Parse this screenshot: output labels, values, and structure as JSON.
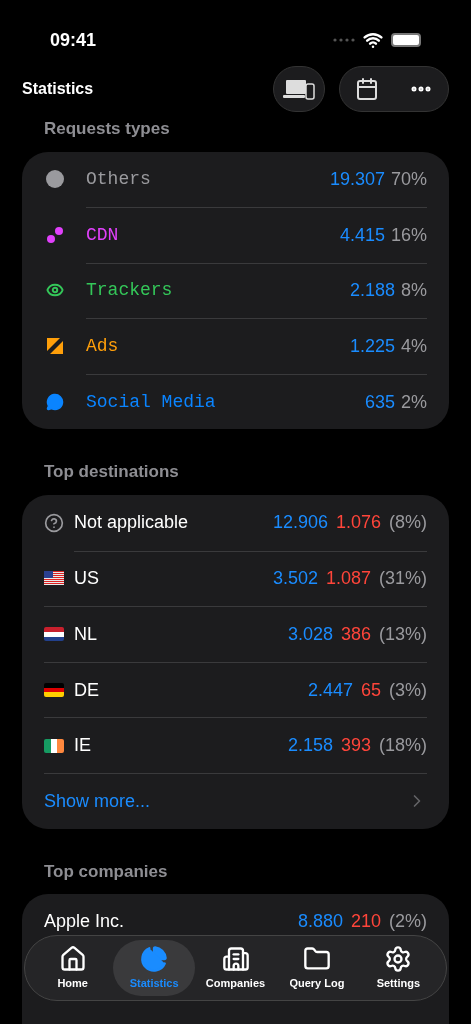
{
  "status_bar": {
    "time": "09:41"
  },
  "header": {
    "title": "Statistics"
  },
  "request_types": {
    "title": "Requests types",
    "items": [
      {
        "label": "Others",
        "count": "19.307",
        "percent": "70%",
        "color": "#9a9a9e"
      },
      {
        "label": "CDN",
        "count": "4.415",
        "percent": "16%",
        "color": "#e040fb"
      },
      {
        "label": "Trackers",
        "count": "2.188",
        "percent": "8%",
        "color": "#34c759"
      },
      {
        "label": "Ads",
        "count": "1.225",
        "percent": "4%",
        "color": "#ff9f0a"
      },
      {
        "label": "Social Media",
        "count": "635",
        "percent": "2%",
        "color": "#0a84ff"
      }
    ]
  },
  "top_destinations": {
    "title": "Top destinations",
    "items": [
      {
        "kind": "unknown",
        "label": "Not applicable",
        "total": "12.906",
        "blocked": "1.076",
        "percent": "(8%)"
      },
      {
        "kind": "us",
        "label": "US",
        "total": "3.502",
        "blocked": "1.087",
        "percent": "(31%)"
      },
      {
        "kind": "nl",
        "label": "NL",
        "total": "3.028",
        "blocked": "386",
        "percent": "(13%)"
      },
      {
        "kind": "de",
        "label": "DE",
        "total": "2.447",
        "blocked": "65",
        "percent": "(3%)"
      },
      {
        "kind": "ie",
        "label": "IE",
        "total": "2.158",
        "blocked": "393",
        "percent": "(18%)"
      }
    ],
    "show_more": "Show more..."
  },
  "top_companies": {
    "title": "Top companies",
    "items": [
      {
        "label": "Apple Inc.",
        "total": "8.880",
        "blocked": "210",
        "percent": "(2%)"
      }
    ]
  },
  "tab_bar": [
    {
      "label": "Home",
      "selected": false
    },
    {
      "label": "Statistics",
      "selected": true
    },
    {
      "label": "Companies",
      "selected": false
    },
    {
      "label": "Query Log",
      "selected": false
    },
    {
      "label": "Settings",
      "selected": false
    }
  ]
}
